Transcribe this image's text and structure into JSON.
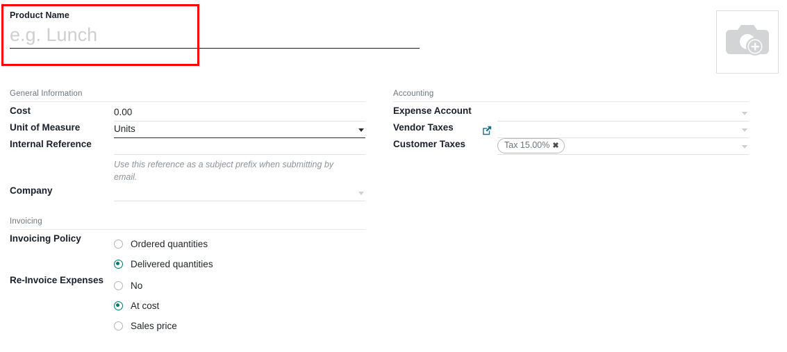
{
  "title_area": {
    "product_name_label": "Product Name",
    "product_name_value": "",
    "product_name_placeholder": "e.g. Lunch",
    "image_placeholder_icon": "camera-add-icon",
    "highlight_color": "#ff0000"
  },
  "general": {
    "section_title": "General Information",
    "fields": {
      "cost_label": "Cost",
      "cost_value": "0.00",
      "uom_label": "Unit of Measure",
      "uom_value": "Units",
      "internal_reference_label": "Internal Reference",
      "internal_reference_value": "",
      "internal_reference_help": "Use this reference as a subject prefix when submitting by email.",
      "company_label": "Company",
      "company_value": ""
    }
  },
  "invoicing": {
    "section_title": "Invoicing",
    "invoicing_policy": {
      "label": "Invoicing Policy",
      "options": [
        {
          "label": "Ordered quantities",
          "selected": false
        },
        {
          "label": "Delivered quantities",
          "selected": true
        }
      ]
    },
    "reinvoice_expenses": {
      "label": "Re-Invoice Expenses",
      "options": [
        {
          "label": "No",
          "selected": false
        },
        {
          "label": "At cost",
          "selected": true
        },
        {
          "label": "Sales price",
          "selected": false
        }
      ]
    }
  },
  "accounting": {
    "section_title": "Accounting",
    "fields": {
      "expense_account_label": "Expense Account",
      "expense_account_value": "",
      "vendor_taxes_label": "Vendor Taxes",
      "vendor_taxes_value": "",
      "customer_taxes_label": "Customer Taxes",
      "customer_taxes_tags": [
        {
          "label": "Tax 15.00%",
          "remove_icon": "✖"
        }
      ]
    }
  },
  "colors": {
    "accent": "#00786f",
    "label": "#1a1f2b",
    "muted": "#6c757d",
    "line": "#e1e1e1"
  }
}
